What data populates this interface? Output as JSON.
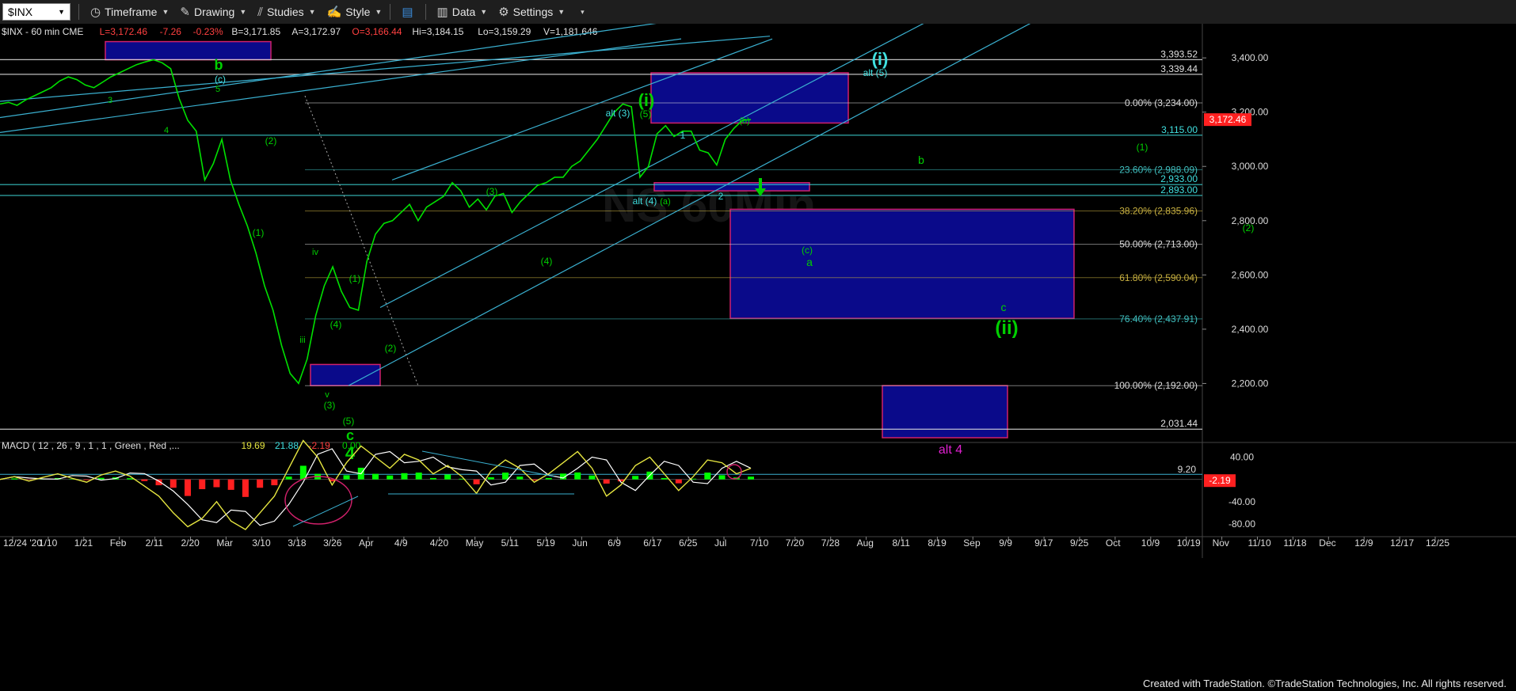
{
  "toolbar": {
    "symbol": "$INX",
    "timeframe": "Timeframe",
    "drawing": "Drawing",
    "studies": "Studies",
    "style": "Style",
    "data": "Data",
    "settings": "Settings"
  },
  "header": {
    "symbol": "$INX - 60 min CME",
    "last": "L=3,172.46",
    "change": "-7.26",
    "change_pct": "-0.23%",
    "bid": "B=3,171.85",
    "ask": "A=3,172.97",
    "open": "O=3,166.44",
    "high": "Hi=3,184.15",
    "low": "Lo=3,159.29",
    "volume": "V=1,181,646"
  },
  "colors": {
    "price": "#00e000",
    "wave_green": "#00d000",
    "wave_cyan": "#40e0e0",
    "channel": "#3ab0d0",
    "box_blue": "#0a0a8a",
    "box_border_red": "#d0206a",
    "fib_line": "#5a5a5a",
    "fib_gold": "#8a7a20",
    "macd_fast": "#e6e640",
    "macd_slow": "#ffffff",
    "hist_pos": "#00ff00",
    "hist_neg": "#ff2020",
    "last_tag": "#ff2020"
  },
  "chart_data": {
    "type": "line",
    "title": "$INX - 60 min CME",
    "yaxis": {
      "range": [
        2000,
        3520
      ],
      "ticks": [
        2200,
        2400,
        2600,
        2800,
        3000,
        3200,
        3400
      ],
      "tick_labels": [
        "2,200.00",
        "2,400.00",
        "2,600.00",
        "2,800.00",
        "3,000.00",
        "3,200.00",
        "3,400.00"
      ]
    },
    "xaxis": {
      "tick_labels": [
        "12/24 '20",
        "1/10",
        "1/21",
        "Feb",
        "2/11",
        "2/20",
        "Mar",
        "3/10",
        "3/18",
        "3/26",
        "Apr",
        "4/9",
        "4/20",
        "May",
        "5/11",
        "5/19",
        "Jun",
        "6/9",
        "6/17",
        "6/25",
        "Jul",
        "7/10",
        "7/20",
        "7/28",
        "Aug",
        "8/11",
        "8/19",
        "Sep",
        "9/9",
        "9/17",
        "9/25",
        "Oct",
        "10/9",
        "10/19",
        "Nov",
        "11/10",
        "11/18",
        "Dec",
        "12/9",
        "12/17",
        "12/25"
      ]
    },
    "series": [
      {
        "values": [
          3230,
          3236,
          3225,
          3245,
          3260,
          3275,
          3290,
          3315,
          3330,
          3320,
          3300,
          3290,
          3310,
          3330,
          3345,
          3360,
          3375,
          3385,
          3393,
          3382,
          3360,
          3250,
          3170,
          3130,
          2950,
          3010,
          3100,
          2950,
          2860,
          2780,
          2680,
          2560,
          2470,
          2340,
          2237,
          2200,
          2290,
          2450,
          2560,
          2630,
          2540,
          2480,
          2470,
          2650,
          2750,
          2790,
          2800,
          2830,
          2860,
          2800,
          2850,
          2870,
          2890,
          2940,
          2910,
          2850,
          2880,
          2840,
          2890,
          2900,
          2830,
          2870,
          2900,
          2930,
          2940,
          2960,
          2960,
          3000,
          3020,
          3060,
          3100,
          3150,
          3200,
          3230,
          3220,
          2960,
          3000,
          3120,
          3150,
          3110,
          3130,
          3130,
          3060,
          3050,
          3005,
          3100,
          3140,
          3170,
          3172.46
        ]
      }
    ],
    "price_labels": [
      {
        "label": "3,393.52",
        "value": 3393.52,
        "color": "#e0e0e0"
      },
      {
        "label": "3,339.44",
        "value": 3339.44,
        "color": "#e0e0e0"
      },
      {
        "label": "3,115.00",
        "value": 3115.0,
        "color": "#40e0e0"
      },
      {
        "label": "2,933.00",
        "value": 2933.0,
        "color": "#40e0e0"
      },
      {
        "label": "2,893.00",
        "value": 2893.0,
        "color": "#40e0e0"
      },
      {
        "label": "2,031.44",
        "value": 2031.44,
        "color": "#e0e0e0"
      }
    ],
    "last_price": {
      "label": "3,172.46",
      "value": 3172.46
    },
    "fib_levels": [
      {
        "label": "0.00% (3,234.00)",
        "value": 3234,
        "color": "#dcdcdc"
      },
      {
        "label": "23.60% (2,988.09)",
        "value": 2988.09,
        "color": "#40c0c0"
      },
      {
        "label": "38.20% (2,835.96)",
        "value": 2835.96,
        "color": "#c8b040"
      },
      {
        "label": "50.00% (2,713.00)",
        "value": 2713,
        "color": "#dcdcdc"
      },
      {
        "label": "61.80% (2,590.04)",
        "value": 2590.04,
        "color": "#c8b040"
      },
      {
        "label": "76.40% (2,437.91)",
        "value": 2437.91,
        "color": "#40c0c0"
      },
      {
        "label": "100.00% (2,192.00)",
        "value": 2192,
        "color": "#dcdcdc"
      }
    ],
    "wave_labels": [
      {
        "text": "b",
        "color": "#00d000",
        "size": 18
      },
      {
        "text": "(c)",
        "color": "#40e0e0",
        "size": 12
      },
      {
        "text": "5",
        "color": "#00d000",
        "size": 11
      },
      {
        "text": "3",
        "color": "#00d000",
        "size": 11
      },
      {
        "text": "4",
        "color": "#00d000",
        "size": 11
      },
      {
        "text": "(2)",
        "color": "#00d000",
        "size": 12
      },
      {
        "text": "(1)",
        "color": "#00d000",
        "size": 12
      },
      {
        "text": "iv",
        "color": "#00d000",
        "size": 11
      },
      {
        "text": "(1)",
        "color": "#00d000",
        "size": 12
      },
      {
        "text": "(4)",
        "color": "#00d000",
        "size": 12
      },
      {
        "text": "iii",
        "color": "#00d000",
        "size": 11
      },
      {
        "text": "v",
        "color": "#00d000",
        "size": 11
      },
      {
        "text": "(3)",
        "color": "#00d000",
        "size": 12
      },
      {
        "text": "(5)",
        "color": "#00d000",
        "size": 12
      },
      {
        "text": "c",
        "color": "#00d000",
        "size": 18
      },
      {
        "text": "4",
        "color": "#00d000",
        "size": 22
      },
      {
        "text": "(2)",
        "color": "#00d000",
        "size": 12
      },
      {
        "text": "(3)",
        "color": "#00d000",
        "size": 12
      },
      {
        "text": "(4)",
        "color": "#00d000",
        "size": 12
      },
      {
        "text": "alt (3)",
        "color": "#40e0e0",
        "size": 12
      },
      {
        "text": "(5)",
        "color": "#00d000",
        "size": 12
      },
      {
        "text": "(i)",
        "color": "#00d000",
        "size": 22
      },
      {
        "text": "1",
        "color": "#40e0e0",
        "size": 12
      },
      {
        "text": "(b)",
        "color": "#00d000",
        "size": 11
      },
      {
        "text": "alt (4)",
        "color": "#40e0e0",
        "size": 12
      },
      {
        "text": "(a)",
        "color": "#00d000",
        "size": 11
      },
      {
        "text": "2",
        "color": "#40e0e0",
        "size": 12
      },
      {
        "text": "(i)",
        "color": "#40e0e0",
        "size": 22
      },
      {
        "text": "alt (5)",
        "color": "#40e0e0",
        "size": 12
      },
      {
        "text": "b",
        "color": "#00d000",
        "size": 14
      },
      {
        "text": "(1)",
        "color": "#00d000",
        "size": 12
      },
      {
        "text": "(2)",
        "color": "#00d000",
        "size": 12
      },
      {
        "text": "(c)",
        "color": "#00d000",
        "size": 12
      },
      {
        "text": "a",
        "color": "#00d000",
        "size": 14
      },
      {
        "text": "c",
        "color": "#00d000",
        "size": 14
      },
      {
        "text": "(ii)",
        "color": "#00d000",
        "size": 24
      },
      {
        "text": "alt 4",
        "color": "#e020d0",
        "size": 16
      }
    ],
    "macd": {
      "title": "MACD ( 12 , 26 , 9 , 1 , 1 , Green , Red ,...",
      "macd_value": "19.69",
      "signal_value": "21.88",
      "hist_value": "-2.19",
      "extra_value": "0.00",
      "axis_labels": [
        "40.00",
        "-40.00",
        "-80.00"
      ],
      "level_label": "9.20",
      "last_tag": "-2.19",
      "values": [
        0,
        5,
        -3,
        4,
        10,
        2,
        -5,
        8,
        15,
        6,
        -12,
        -30,
        -60,
        -85,
        -70,
        -40,
        -75,
        -90,
        -60,
        -30,
        20,
        70,
        40,
        -10,
        30,
        60,
        40,
        20,
        45,
        35,
        10,
        25,
        5,
        -25,
        15,
        35,
        20,
        -5,
        10,
        30,
        50,
        20,
        -30,
        -10,
        25,
        40,
        10,
        -20,
        5,
        35,
        30,
        10,
        20
      ]
    }
  },
  "footer": {
    "credit": "Created with TradeStation. ©TradeStation Technologies, Inc. All rights reserved."
  }
}
